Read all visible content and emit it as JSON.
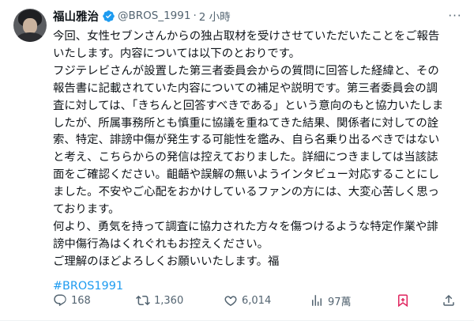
{
  "tweet": {
    "author_name": "福山雅治",
    "handle": "@BROS_1991",
    "separator": "·",
    "time": "2 小時",
    "more_label": "···",
    "lines": [
      "今回、女性セブンさんからの独占取材を受けさせていただいたことをご報告",
      "いたします。内容については以下のとおりです。",
      "フジテレビさんが設置した第三者委員会からの質問に回答した経緯と、その",
      "報告書に記載されていた内容についての補足や説明です。第三者委員会の調",
      "査に対しては、「きちんと回答すべきである」という意向のもと協力いたしま",
      "したが、所属事務所とも慎重に協議を重ねてきた結果、関係者に対しての詮",
      "索、特定、誹謗中傷が発生する可能性を鑑み、自ら名乗り出るべきではない",
      "と考え、こちらからの発信は控えておりました。詳細につきましては当該誌",
      "面をご確認ください。齟齬や誤解の無いようインタビュー対応することにし",
      "ました。不安やご心配をおかけしているファンの方には、大変心苦しく思っ",
      "ております。",
      "何より、勇気を持って調査に協力された方々を傷つけるような特定作業や誹",
      "謗中傷行為はくれぐれもお控えください。",
      "ご理解のほどよろしくお願いいたします。福"
    ],
    "hashtag": "#BROS1991"
  },
  "actions": {
    "reply_count": "168",
    "retweet_count": "1,360",
    "like_count": "6,014",
    "views_count": "97萬"
  },
  "icons": {
    "verified": "verified-badge-icon",
    "reply": "reply-icon",
    "retweet": "retweet-icon",
    "like": "heart-icon",
    "views": "views-bar-chart-icon",
    "bookmark": "bookmark-icon",
    "share": "share-icon"
  },
  "colors": {
    "text": "#0f1419",
    "secondary": "#536471",
    "accent": "#1d9bf0",
    "bookmark_active": "#e0245e"
  }
}
